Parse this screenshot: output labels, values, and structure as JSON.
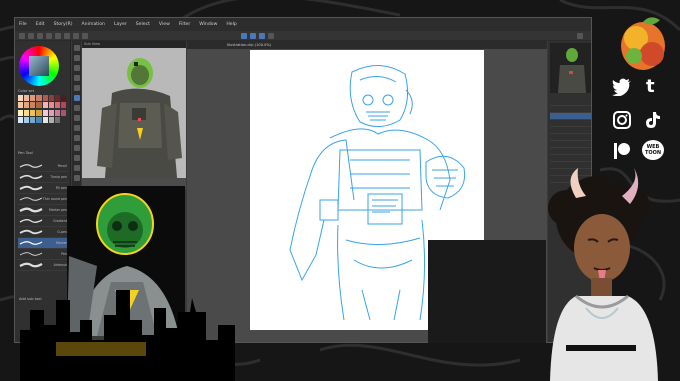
{
  "menu": [
    "File",
    "Edit",
    "Story(R)",
    "Animation",
    "Layer",
    "Select",
    "View",
    "Filter",
    "Window",
    "Help"
  ],
  "left_panel": {
    "swatch_label": "Color set",
    "brush_label": "Pen Tool",
    "brushes": [
      "Pencil",
      "Turnip pen",
      "Fill pen",
      "Thin round pen",
      "Marker pen",
      "Gradient",
      "G-pen",
      "Marker",
      "Pen",
      "Airbrush"
    ],
    "footer_label": "Add sub tool"
  },
  "reference_title": "Sub View",
  "canvas_tab": "Illustration.clip (100.0%)",
  "right_panel_rows": 14,
  "socials": {
    "labels": [
      "twitter",
      "tumblr",
      "instagram",
      "tiktok",
      "patreon",
      "webtoon"
    ],
    "webtoon_text": "WEB TOON"
  },
  "colors": {
    "app_bg": "#3b3b3b",
    "sketch_blue": "#3ba3e6",
    "accent_yellow": "#f5d21c",
    "helmet_green": "#2f9e3a"
  }
}
